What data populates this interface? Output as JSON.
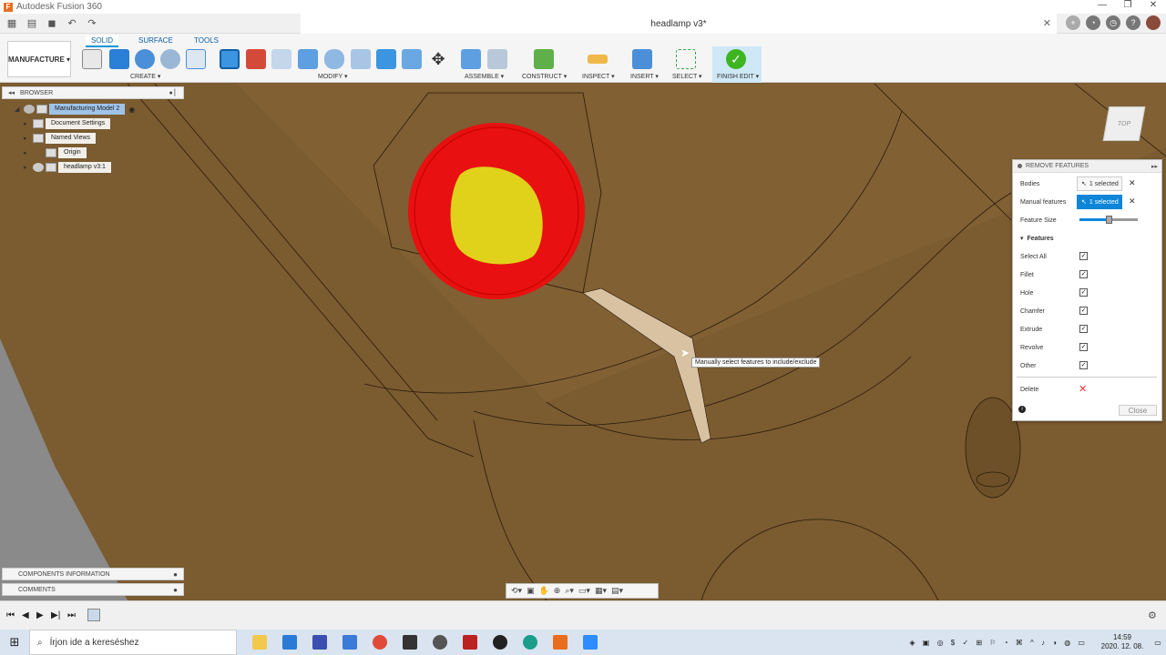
{
  "window": {
    "app_title": "Autodesk Fusion 360",
    "doc_tab": "headlamp v3*"
  },
  "toolbar": {
    "workspace": "MANUFACTURE ▾",
    "tabs": [
      "SOLID",
      "SURFACE",
      "TOOLS"
    ],
    "groups": [
      "CREATE ▾",
      "MODIFY ▾",
      "ASSEMBLE ▾",
      "CONSTRUCT ▾",
      "INSPECT ▾",
      "INSERT ▾",
      "SELECT ▾",
      "FINISH EDIT ▾"
    ]
  },
  "browser": {
    "title": "BROWSER",
    "items": [
      {
        "label": "Manufacturing Model 2"
      },
      {
        "label": "Document Settings"
      },
      {
        "label": "Named Views"
      },
      {
        "label": "Origin"
      },
      {
        "label": "headlamp v3:1"
      }
    ],
    "components_info": "COMPONENTS INFORMATION",
    "comments": "COMMENTS"
  },
  "remove_features": {
    "title": "REMOVE FEATURES",
    "bodies_label": "Bodies",
    "bodies_value": "1 selected",
    "manual_label": "Manual features",
    "manual_value": "1 selected",
    "feature_size_label": "Feature Size",
    "feature_size_level": 0.5,
    "features_header": "Features",
    "feature_rows": [
      {
        "label": "Select All",
        "checked": true
      },
      {
        "label": "Fillet",
        "checked": true
      },
      {
        "label": "Hole",
        "checked": true
      },
      {
        "label": "Chamfer",
        "checked": true
      },
      {
        "label": "Extrude",
        "checked": true
      },
      {
        "label": "Revolve",
        "checked": true
      },
      {
        "label": "Other",
        "checked": true
      }
    ],
    "delete_label": "Delete",
    "close_label": "Close"
  },
  "viewport": {
    "tooltip": "Manually select features to include/exclude",
    "viewcube_label": "TOP"
  },
  "taskbar": {
    "search_placeholder": "Írjon ide a kereséshez",
    "time": "14:59",
    "date": "2020. 12. 08."
  },
  "colors": {
    "model": "#7a5a2e",
    "red_face": "#e81010",
    "yellow_face": "#e0d21a",
    "accent": "#0d86d9"
  }
}
